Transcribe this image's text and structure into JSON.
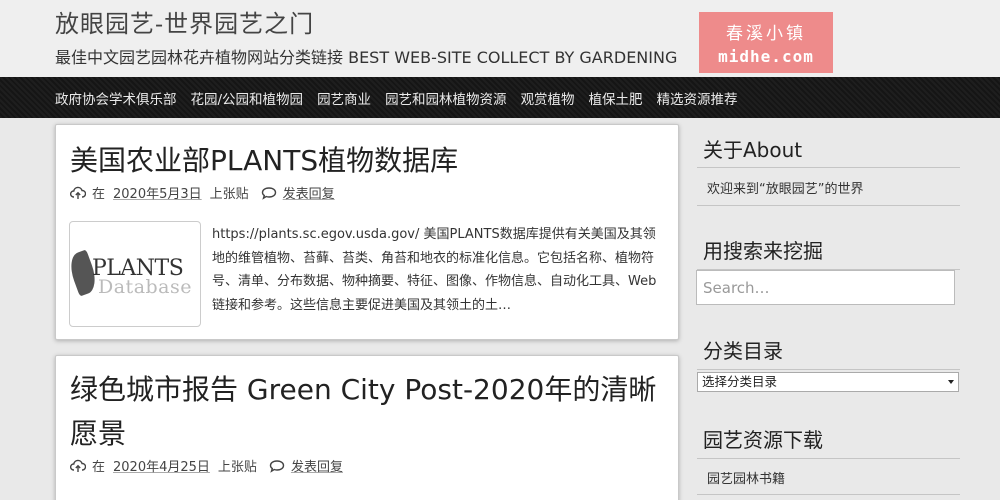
{
  "header": {
    "site_title": "放眼园艺-世界园艺之门",
    "site_desc": "最佳中文园艺园林花卉植物网站分类链接 BEST WEB-SITE COLLECT BY GARDENING",
    "logo_line1": "春溪小镇",
    "logo_line2": "midhe.com",
    "logo_color": "#ee8b8b"
  },
  "nav": {
    "items": [
      "政府协会学术俱乐部",
      "花园/公园和植物园",
      "园艺商业",
      "园艺和园林植物资源",
      "观赏植物",
      "植保土肥",
      "精选资源推荐"
    ]
  },
  "posts": [
    {
      "title": "美国农业部PLANTS植物数据库",
      "meta_prefix": "在",
      "date": "2020年5月3日",
      "meta_posted": "上张贴",
      "comment": "发表回复",
      "thumb_line1": "PLANTS",
      "thumb_line2": "Database",
      "excerpt": "https://plants.sc.egov.usda.gov/ 美国PLANTS数据库提供有关美国及其领地的维管植物、苔藓、苔类、角苔和地衣的标准化信息。它包括名称、植物符号、清单、分布数据、物种摘要、特征、图像、作物信息、自动化工具、Web链接和参考。这些信息主要促进美国及其领土的土…"
    },
    {
      "title": "绿色城市报告 Green City Post-2020年的清晰愿景",
      "meta_prefix": "在",
      "date": "2020年4月25日",
      "meta_posted": "上张贴",
      "comment": "发表回复"
    }
  ],
  "sidebar": {
    "about_title": "关于About",
    "about_text": "欢迎来到“放眼园艺”的世界",
    "search_title": "用搜索来挖掘",
    "search_placeholder": "Search…",
    "category_title": "分类目录",
    "category_selected": "选择分类目录",
    "download_title": "园艺资源下载",
    "download_item": "园艺园林书籍"
  }
}
